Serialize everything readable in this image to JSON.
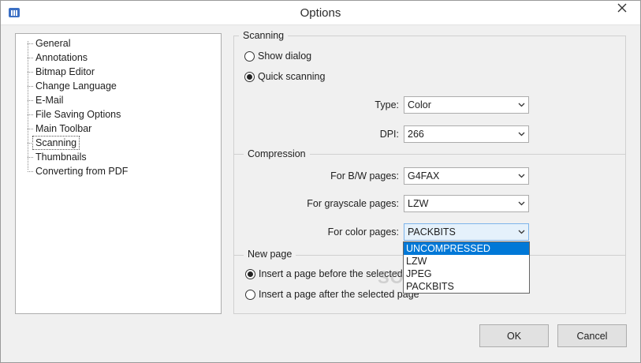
{
  "window": {
    "title": "Options"
  },
  "tree": {
    "items": [
      {
        "label": "General"
      },
      {
        "label": "Annotations"
      },
      {
        "label": "Bitmap Editor"
      },
      {
        "label": "Change Language"
      },
      {
        "label": "E-Mail"
      },
      {
        "label": "File Saving Options"
      },
      {
        "label": "Main Toolbar"
      },
      {
        "label": "Scanning",
        "selected": true
      },
      {
        "label": "Thumbnails"
      },
      {
        "label": "Converting from PDF"
      }
    ]
  },
  "scanning": {
    "title": "Scanning",
    "show_dialog": "Show dialog",
    "quick_scanning": "Quick scanning",
    "type_label": "Type:",
    "type_value": "Color",
    "dpi_label": "DPI:",
    "dpi_value": "266"
  },
  "compression": {
    "title": "Compression",
    "bw_label": "For B/W pages:",
    "bw_value": "G4FAX",
    "gray_label": "For grayscale pages:",
    "gray_value": "LZW",
    "color_label": "For color pages:",
    "color_value": "PACKBITS",
    "dropdown_options": [
      "UNCOMPRESSED",
      "LZW",
      "JPEG",
      "PACKBITS"
    ]
  },
  "new_page": {
    "title": "New page",
    "before": "Insert a page before the selected page",
    "after": "Insert a page after the selected page"
  },
  "buttons": {
    "ok": "OK",
    "cancel": "Cancel"
  },
  "watermark": "SOFTPEDIA",
  "colors": {
    "highlight": "#0078d7",
    "combo_open_bg": "#e5f1fb"
  }
}
